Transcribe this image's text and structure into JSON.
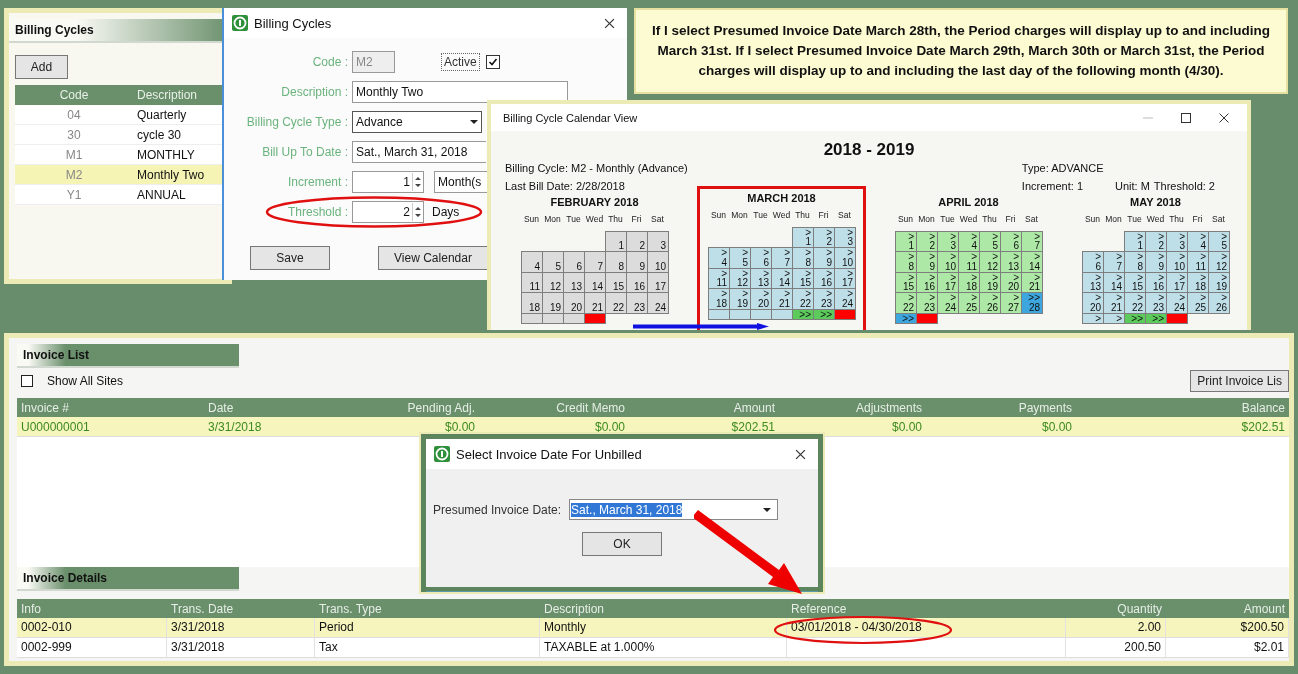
{
  "cycles_panel": {
    "title": "Billing Cycles",
    "add_button": "Add",
    "columns": [
      "Code",
      "Description"
    ],
    "rows": [
      {
        "code": "04",
        "description": "Quarterly",
        "selected": false
      },
      {
        "code": "30",
        "description": "cycle 30",
        "selected": false
      },
      {
        "code": "M1",
        "description": "MONTHLY",
        "selected": false
      },
      {
        "code": "M2",
        "description": "Monthly Two",
        "selected": true
      },
      {
        "code": "Y1",
        "description": "ANNUAL",
        "selected": false
      }
    ]
  },
  "cycle_dialog": {
    "title": "Billing Cycles",
    "code_label": "Code :",
    "code": "M2",
    "active_label": "Active",
    "active": true,
    "description_label": "Description :",
    "description": "Monthly Two",
    "type_label": "Billing Cycle Type :",
    "type": "Advance",
    "bill_up_to_label": "Bill Up To Date :",
    "bill_up_to": "Sat., March 31, 2018",
    "increment_label": "Increment :",
    "increment": "1",
    "increment_unit": "Month(s",
    "threshold_label": "Threshold :",
    "threshold": "2",
    "threshold_unit": "Days",
    "buttons": [
      "Save",
      "View Calendar"
    ]
  },
  "note": "If I select Presumed Invoice Date March 28th, the Period charges will display up to and including March 31st. If I select  Presumed Invoice Date March 29th,  March 30th or March 31st, the Period charges will display up to and including the last day of the following month (4/30).",
  "calendar": {
    "title": "Billing Cycle Calendar View",
    "year": "2018 - 2019",
    "cycle": "Billing Cycle: M2 - Monthly (Advance)",
    "last_bill": "Last Bill Date: 2/28/2018",
    "type": "Type: ADVANCE",
    "increment": "Increment: 1",
    "unit": "Unit: M",
    "threshold": "Threshold: 2",
    "months": [
      {
        "name": "FEBRUARY 2018",
        "highlighted": false,
        "weekdays": [
          "Sun",
          "Mon",
          "Tue",
          "Wed",
          "Thu",
          "Fri",
          "Sat"
        ],
        "days": [
          {
            "kind": "blank"
          },
          {
            "kind": "blank"
          },
          {
            "kind": "blank"
          },
          {
            "kind": "blank"
          },
          {
            "kind": "past",
            "n": "1"
          },
          {
            "kind": "past",
            "n": "2"
          },
          {
            "kind": "past",
            "n": "3"
          },
          {
            "kind": "past",
            "n": "4"
          },
          {
            "kind": "past",
            "n": "5"
          },
          {
            "kind": "past",
            "n": "6"
          },
          {
            "kind": "past",
            "n": "7"
          },
          {
            "kind": "past",
            "n": "8"
          },
          {
            "kind": "past",
            "n": "9"
          },
          {
            "kind": "past",
            "n": "10"
          },
          {
            "kind": "past",
            "n": "11"
          },
          {
            "kind": "past",
            "n": "12"
          },
          {
            "kind": "past",
            "n": "13"
          },
          {
            "kind": "past",
            "n": "14"
          },
          {
            "kind": "past",
            "n": "15"
          },
          {
            "kind": "past",
            "n": "16"
          },
          {
            "kind": "past",
            "n": "17"
          },
          {
            "kind": "past",
            "n": "18"
          },
          {
            "kind": "past",
            "n": "19"
          },
          {
            "kind": "past",
            "n": "20"
          },
          {
            "kind": "past",
            "n": "21"
          },
          {
            "kind": "past",
            "n": "22"
          },
          {
            "kind": "past",
            "n": "23"
          },
          {
            "kind": "past",
            "n": "24"
          },
          {
            "kind": "past"
          },
          {
            "kind": "past"
          },
          {
            "kind": "past"
          },
          {
            "kind": "bill"
          }
        ]
      },
      {
        "name": "MARCH 2018",
        "highlighted": true,
        "weekdays": [
          "Sun",
          "Mon",
          "Tue",
          "Wed",
          "Thu",
          "Fri",
          "Sat"
        ],
        "days": [
          {
            "kind": "blank"
          },
          {
            "kind": "blank"
          },
          {
            "kind": "blank"
          },
          {
            "kind": "blank"
          },
          {
            "kind": "cur",
            "mark": ">",
            "n": "1"
          },
          {
            "kind": "cur",
            "mark": ">",
            "n": "2"
          },
          {
            "kind": "cur",
            "mark": ">",
            "n": "3"
          },
          {
            "kind": "cur",
            "mark": ">",
            "n": "4"
          },
          {
            "kind": "cur",
            "mark": ">",
            "n": "5"
          },
          {
            "kind": "cur",
            "mark": ">",
            "n": "6"
          },
          {
            "kind": "cur",
            "mark": ">",
            "n": "7"
          },
          {
            "kind": "cur",
            "mark": ">",
            "n": "8"
          },
          {
            "kind": "cur",
            "mark": ">",
            "n": "9"
          },
          {
            "kind": "cur",
            "mark": ">",
            "n": "10"
          },
          {
            "kind": "cur",
            "mark": ">",
            "n": "11"
          },
          {
            "kind": "cur",
            "mark": ">",
            "n": "12"
          },
          {
            "kind": "cur",
            "mark": ">",
            "n": "13"
          },
          {
            "kind": "cur",
            "mark": ">",
            "n": "14"
          },
          {
            "kind": "cur",
            "mark": ">",
            "n": "15"
          },
          {
            "kind": "cur",
            "mark": ">",
            "n": "16"
          },
          {
            "kind": "cur",
            "mark": ">",
            "n": "17"
          },
          {
            "kind": "cur",
            "mark": ">",
            "n": "18"
          },
          {
            "kind": "cur",
            "mark": ">",
            "n": "19"
          },
          {
            "kind": "cur",
            "mark": ">",
            "n": "20"
          },
          {
            "kind": "cur",
            "mark": ">",
            "n": "21"
          },
          {
            "kind": "cur",
            "mark": ">",
            "n": "22"
          },
          {
            "kind": "cur",
            "mark": ">",
            "n": "23"
          },
          {
            "kind": "cur",
            "mark": ">",
            "n": "24"
          },
          {
            "kind": "cur"
          },
          {
            "kind": "cur"
          },
          {
            "kind": "cur"
          },
          {
            "kind": "cur"
          },
          {
            "kind": "thresh",
            "mark": ">>"
          },
          {
            "kind": "thresh",
            "mark": ">>"
          },
          {
            "kind": "bill"
          }
        ]
      },
      {
        "name": "APRIL 2018",
        "highlighted": false,
        "weekdays": [
          "Sun",
          "Mon",
          "Tue",
          "Wed",
          "Thu",
          "Fri",
          "Sat"
        ],
        "days": [
          {
            "kind": "next",
            "mark": ">",
            "n": "1"
          },
          {
            "kind": "next",
            "mark": ">",
            "n": "2"
          },
          {
            "kind": "next",
            "mark": ">",
            "n": "3"
          },
          {
            "kind": "next",
            "mark": ">",
            "n": "4"
          },
          {
            "kind": "next",
            "mark": ">",
            "n": "5"
          },
          {
            "kind": "next",
            "mark": ">",
            "n": "6"
          },
          {
            "kind": "next",
            "mark": ">",
            "n": "7"
          },
          {
            "kind": "next",
            "mark": ">",
            "n": "8"
          },
          {
            "kind": "next",
            "mark": ">",
            "n": "9"
          },
          {
            "kind": "next",
            "mark": ">",
            "n": "10"
          },
          {
            "kind": "next",
            "mark": ">",
            "n": "11"
          },
          {
            "kind": "next",
            "mark": ">",
            "n": "12"
          },
          {
            "kind": "next",
            "mark": ">",
            "n": "13"
          },
          {
            "kind": "next",
            "mark": ">",
            "n": "14"
          },
          {
            "kind": "next",
            "mark": ">",
            "n": "15"
          },
          {
            "kind": "next",
            "mark": ">",
            "n": "16"
          },
          {
            "kind": "next",
            "mark": ">",
            "n": "17"
          },
          {
            "kind": "next",
            "mark": ">",
            "n": "18"
          },
          {
            "kind": "next",
            "mark": ">",
            "n": "19"
          },
          {
            "kind": "next",
            "mark": ">",
            "n": "20"
          },
          {
            "kind": "next",
            "mark": ">",
            "n": "21"
          },
          {
            "kind": "next",
            "mark": ">",
            "n": "22"
          },
          {
            "kind": "next",
            "mark": ">",
            "n": "23"
          },
          {
            "kind": "next",
            "mark": ">",
            "n": "24"
          },
          {
            "kind": "next",
            "mark": ">",
            "n": "25"
          },
          {
            "kind": "next",
            "mark": ">",
            "n": "26"
          },
          {
            "kind": "next",
            "mark": ">",
            "n": "27"
          },
          {
            "kind": "alt",
            "mark": ">>",
            "n": "28"
          },
          {
            "kind": "alt",
            "mark": ">>"
          },
          {
            "kind": "bill"
          }
        ]
      },
      {
        "name": "MAY 2018",
        "highlighted": false,
        "weekdays": [
          "Sun",
          "Mon",
          "Tue",
          "Wed",
          "Thu",
          "Fri",
          "Sat"
        ],
        "days": [
          {
            "kind": "blank"
          },
          {
            "kind": "blank"
          },
          {
            "kind": "cur",
            "mark": ">",
            "n": "1"
          },
          {
            "kind": "cur",
            "mark": ">",
            "n": "2"
          },
          {
            "kind": "cur",
            "mark": ">",
            "n": "3"
          },
          {
            "kind": "cur",
            "mark": ">",
            "n": "4"
          },
          {
            "kind": "cur",
            "mark": ">",
            "n": "5"
          },
          {
            "kind": "cur",
            "mark": ">",
            "n": "6"
          },
          {
            "kind": "cur",
            "mark": ">",
            "n": "7"
          },
          {
            "kind": "cur",
            "mark": ">",
            "n": "8"
          },
          {
            "kind": "cur",
            "mark": ">",
            "n": "9"
          },
          {
            "kind": "cur",
            "mark": ">",
            "n": "10"
          },
          {
            "kind": "cur",
            "mark": ">",
            "n": "11"
          },
          {
            "kind": "cur",
            "mark": ">",
            "n": "12"
          },
          {
            "kind": "cur",
            "mark": ">",
            "n": "13"
          },
          {
            "kind": "cur",
            "mark": ">",
            "n": "14"
          },
          {
            "kind": "cur",
            "mark": ">",
            "n": "15"
          },
          {
            "kind": "cur",
            "mark": ">",
            "n": "16"
          },
          {
            "kind": "cur",
            "mark": ">",
            "n": "17"
          },
          {
            "kind": "cur",
            "mark": ">",
            "n": "18"
          },
          {
            "kind": "cur",
            "mark": ">",
            "n": "19"
          },
          {
            "kind": "cur",
            "mark": ">",
            "n": "20"
          },
          {
            "kind": "cur",
            "mark": ">",
            "n": "21"
          },
          {
            "kind": "cur",
            "mark": ">",
            "n": "22"
          },
          {
            "kind": "cur",
            "mark": ">",
            "n": "23"
          },
          {
            "kind": "cur",
            "mark": ">",
            "n": "24"
          },
          {
            "kind": "cur",
            "mark": ">",
            "n": "25"
          },
          {
            "kind": "cur",
            "mark": ">",
            "n": "26"
          },
          {
            "kind": "cur",
            "mark": ">"
          },
          {
            "kind": "cur",
            "mark": ">"
          },
          {
            "kind": "thresh",
            "mark": ">>"
          },
          {
            "kind": "thresh",
            "mark": ">>"
          },
          {
            "kind": "bill"
          }
        ]
      }
    ]
  },
  "invoice_list": {
    "title": "Invoice List",
    "show_all_sites": {
      "label": "Show All Sites",
      "checked": false
    },
    "print_button": "Print Invoice Lis",
    "columns": [
      "Invoice #",
      "Date",
      "Pending Adj.",
      "Credit Memo",
      "Amount",
      "Adjustments",
      "Payments",
      "Balance"
    ],
    "rows": [
      {
        "selected": true,
        "cells": [
          "U000000001",
          "3/31/2018",
          "$0.00",
          "$0.00",
          "$202.51",
          "$0.00",
          "$0.00",
          "$202.51"
        ]
      }
    ]
  },
  "invoice_details": {
    "title": "Invoice Details",
    "columns": [
      "Info",
      "Trans. Date",
      "Trans. Type",
      "Description",
      "Reference",
      "Quantity",
      "Amount"
    ],
    "rows": [
      {
        "selected": true,
        "cells": [
          "0002-010",
          "3/31/2018",
          "Period",
          "Monthly",
          "03/01/2018 - 04/30/2018",
          "2.00",
          "$200.50"
        ]
      },
      {
        "selected": false,
        "cells": [
          "0002-999",
          "3/31/2018",
          "Tax",
          "TAXABLE at 1.000%",
          "",
          "200.50",
          "$2.01"
        ]
      }
    ]
  },
  "date_dialog": {
    "title": "Select Invoice Date For Unbilled",
    "label": "Presumed Invoice Date:",
    "value": "Sat., March 31, 2018",
    "ok": "OK"
  }
}
